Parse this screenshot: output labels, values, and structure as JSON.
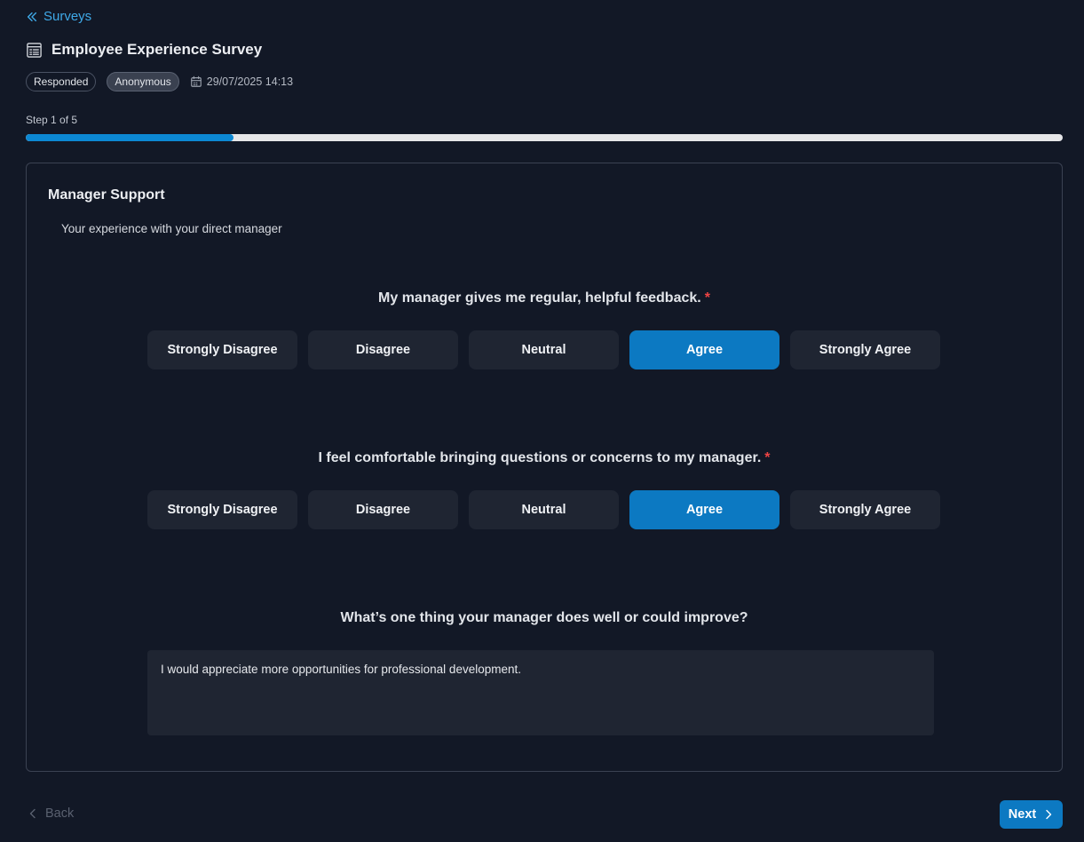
{
  "breadcrumb": {
    "label": "Surveys",
    "icon": "chevrons-left-icon"
  },
  "survey": {
    "title": "Employee Experience Survey",
    "icon": "survey-list-icon",
    "badges": [
      "Responded",
      "Anonymous"
    ],
    "date": "29/07/2025 14:13",
    "date_icon": "calendar-icon"
  },
  "progress": {
    "label": "Step 1 of 5",
    "fraction": 0.2
  },
  "section": {
    "title": "Manager Support",
    "description": "Your experience with your direct manager"
  },
  "questions": [
    {
      "text": "My manager gives me regular, helpful feedback.",
      "required_mark": "*",
      "options": [
        "Strongly Disagree",
        "Disagree",
        "Neutral",
        "Agree",
        "Strongly Agree"
      ],
      "selected": "Agree"
    },
    {
      "text": "I feel comfortable bringing questions or concerns to my manager.",
      "required_mark": "*",
      "options": [
        "Strongly Disagree",
        "Disagree",
        "Neutral",
        "Agree",
        "Strongly Agree"
      ],
      "selected": "Agree"
    },
    {
      "text": "What’s one thing your manager does well or could improve?",
      "answer": "I would appreciate more opportunities for professional development."
    }
  ],
  "navigation": {
    "back_label": "Back",
    "next_label": "Next"
  },
  "colors": {
    "accent": "#0c79c2",
    "link": "#3fa9e8",
    "required": "#ef4444",
    "background": "#121826"
  }
}
